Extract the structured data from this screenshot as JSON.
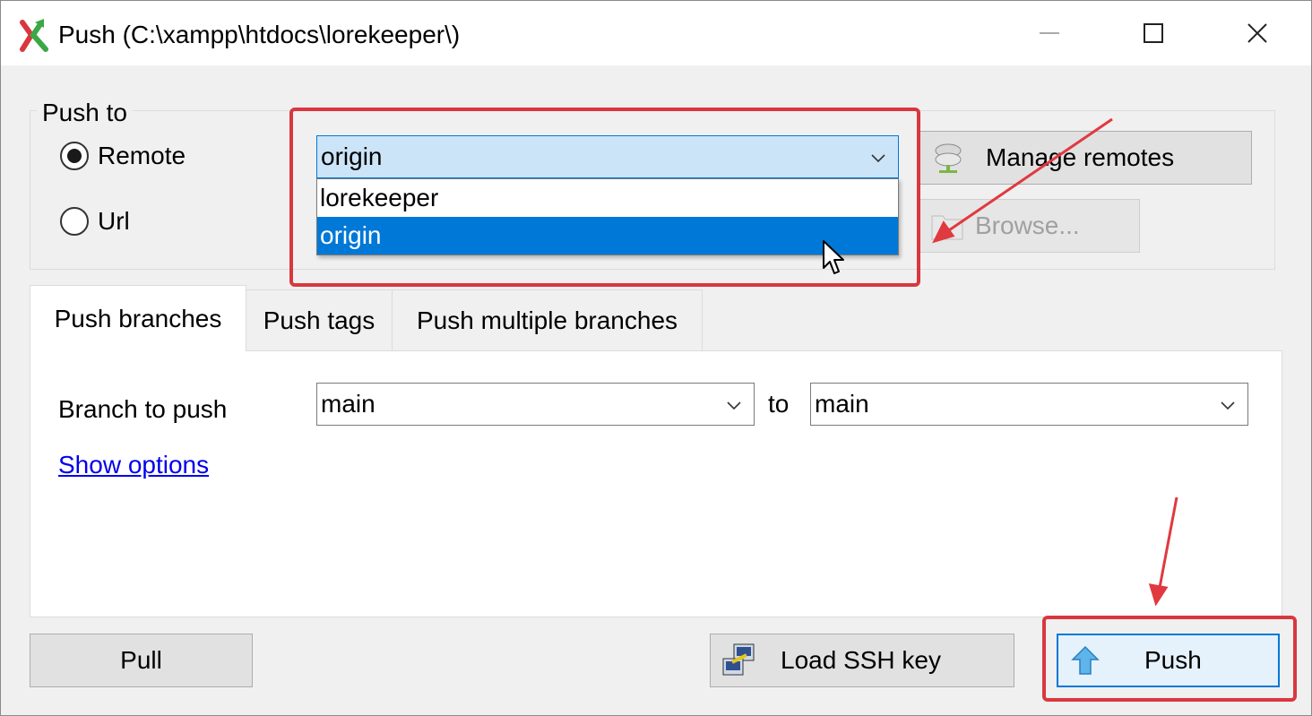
{
  "window": {
    "title": "Push (C:\\xampp\\htdocs\\lorekeeper\\)",
    "minimize_icon": "minimize-icon",
    "maximize_icon": "maximize-icon",
    "close_icon": "close-icon"
  },
  "push_to": {
    "group_label": "Push to",
    "remote_label": "Remote",
    "url_label": "Url",
    "selected_option": "Remote",
    "remote_combo": {
      "value": "origin",
      "options": [
        "lorekeeper",
        "origin"
      ],
      "highlighted": "origin"
    },
    "manage_remotes_label": "Manage remotes",
    "browse_label": "Browse..."
  },
  "tabs": [
    {
      "label": "Push branches",
      "active": true
    },
    {
      "label": "Push tags",
      "active": false
    },
    {
      "label": "Push multiple branches",
      "active": false
    }
  ],
  "branches": {
    "branch_to_push_label": "Branch to push",
    "local_branch": "main",
    "to_label": "to",
    "remote_branch": "main",
    "show_options_link": "Show options"
  },
  "footer": {
    "pull_label": "Pull",
    "load_ssh_key_label": "Load SSH key",
    "push_label": "Push"
  },
  "colors": {
    "accent": "#0078d7",
    "annotation": "#d9373f",
    "link": "#0000ee"
  }
}
